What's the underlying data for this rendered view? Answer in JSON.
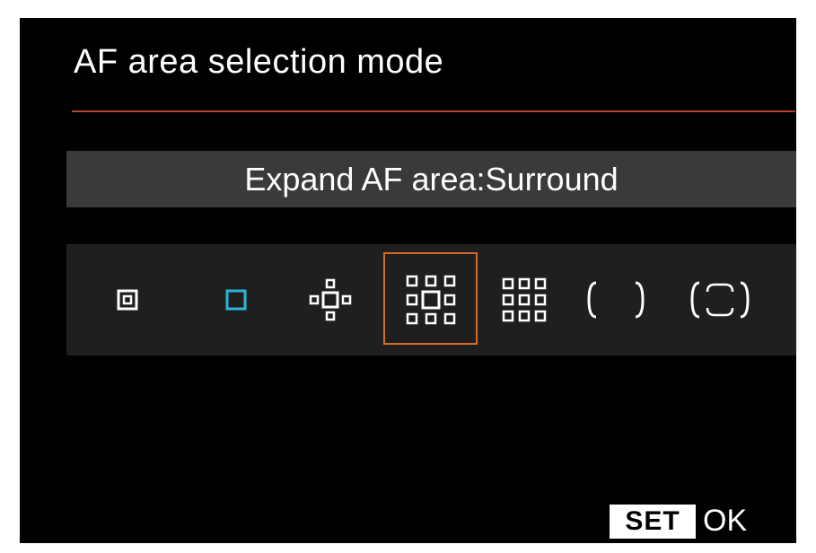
{
  "screen": {
    "title": "AF area selection mode",
    "current_mode": "Expand AF area:Surround"
  },
  "af_modes": {
    "selected_index": 3,
    "items": [
      {
        "icon": "spot-af-icon"
      },
      {
        "icon": "single-point-af-icon"
      },
      {
        "icon": "expand-af-area-icon"
      },
      {
        "icon": "expand-af-area-surround-icon"
      },
      {
        "icon": "zone-af-icon"
      },
      {
        "icon": "large-zone-af-icon"
      },
      {
        "icon": "auto-selection-af-icon"
      }
    ]
  },
  "footer": {
    "set_label": "SET",
    "ok_label": "OK"
  },
  "colors": {
    "accent_rule": "#b0442a",
    "selection_border": "#d86a22",
    "active_icon": "#29b6d6"
  }
}
